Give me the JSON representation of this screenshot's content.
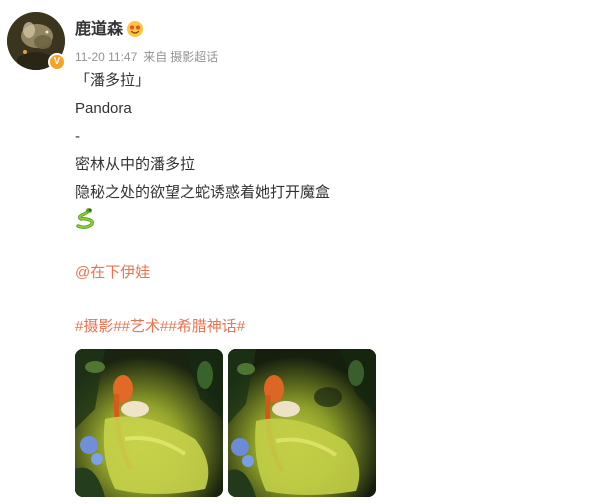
{
  "post": {
    "author": {
      "name": "鹿道森",
      "avatar_icon": "avatar-image",
      "verified_icon": "verified-v-icon",
      "verified_label": "V",
      "vip_icon": "vip-emoji-icon",
      "badge_color": "#f7a227"
    },
    "meta": {
      "time": "11-20 11:47",
      "from": "来自",
      "source": "摄影超话"
    },
    "text_lines": [
      "「潘多拉」",
      "Pandora",
      "-",
      "密林从中的潘多拉",
      "隐秘之处的欲望之蛇诱惑着她打开魔盒"
    ],
    "emoji_icon": "snake-icon",
    "mention": "@在下伊娃",
    "hashtags": "#摄影##艺术##希腊神话#",
    "link_color": "#eb7350",
    "photos": [
      {
        "icon": "photo-pandora-forest-1"
      },
      {
        "icon": "photo-pandora-forest-2"
      }
    ]
  }
}
